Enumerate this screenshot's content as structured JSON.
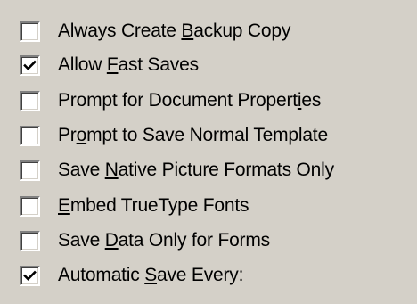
{
  "options": [
    {
      "pre": "Always Create ",
      "key": "B",
      "post": "ackup Copy",
      "checked": false
    },
    {
      "pre": "Allow ",
      "key": "F",
      "post": "ast Saves",
      "checked": true
    },
    {
      "pre": "Prompt for Document Propert",
      "key": "i",
      "post": "es",
      "checked": false
    },
    {
      "pre": "Pr",
      "key": "o",
      "post": "mpt to Save Normal Template",
      "checked": false
    },
    {
      "pre": "Save ",
      "key": "N",
      "post": "ative Picture Formats Only",
      "checked": false
    },
    {
      "pre": "",
      "key": "E",
      "post": "mbed TrueType Fonts",
      "checked": false
    },
    {
      "pre": "Save ",
      "key": "D",
      "post": "ata Only for Forms",
      "checked": false
    },
    {
      "pre": "Automatic ",
      "key": "S",
      "post": "ave Every:",
      "checked": true
    }
  ],
  "colors": {
    "dialog_face": "#d4d0c8",
    "checkbox_fill": "#ffffff",
    "text": "#000000"
  }
}
